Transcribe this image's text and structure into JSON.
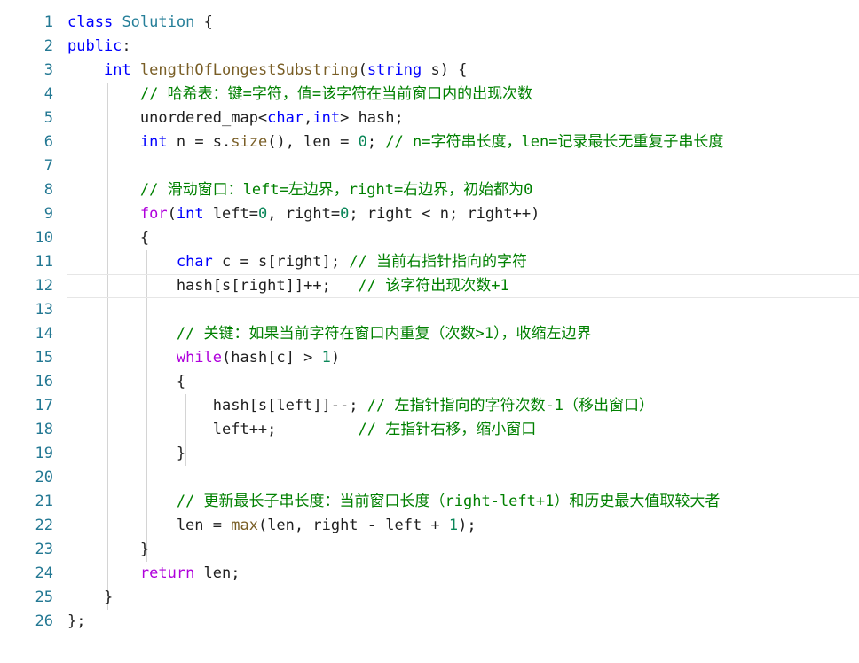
{
  "editor": {
    "lines": [
      {
        "n": "1",
        "tokens": [
          [
            "kw",
            "class"
          ],
          [
            "p",
            " "
          ],
          [
            "cls",
            "Solution"
          ],
          [
            "p",
            " {"
          ]
        ]
      },
      {
        "n": "2",
        "tokens": [
          [
            "kw",
            "public"
          ],
          [
            "p",
            ":"
          ]
        ]
      },
      {
        "n": "3",
        "tokens": [
          [
            "p",
            "    "
          ],
          [
            "ty",
            "int"
          ],
          [
            "p",
            " "
          ],
          [
            "fn",
            "lengthOfLongestSubstring"
          ],
          [
            "p",
            "("
          ],
          [
            "ty",
            "string"
          ],
          [
            "p",
            " s) {"
          ]
        ]
      },
      {
        "n": "4",
        "tokens": [
          [
            "p",
            "        "
          ],
          [
            "cm",
            "// 哈希表：键=字符，值=该字符在当前窗口内的出现次数"
          ]
        ]
      },
      {
        "n": "5",
        "tokens": [
          [
            "p",
            "        unordered_map<"
          ],
          [
            "ty",
            "char"
          ],
          [
            "p",
            ","
          ],
          [
            "ty",
            "int"
          ],
          [
            "p",
            "> hash;"
          ]
        ]
      },
      {
        "n": "6",
        "tokens": [
          [
            "p",
            "        "
          ],
          [
            "ty",
            "int"
          ],
          [
            "p",
            " n = s."
          ],
          [
            "fn",
            "size"
          ],
          [
            "p",
            "(), len = "
          ],
          [
            "num",
            "0"
          ],
          [
            "p",
            "; "
          ],
          [
            "cm",
            "// n=字符串长度，len=记录最长无重复子串长度"
          ]
        ]
      },
      {
        "n": "7",
        "tokens": []
      },
      {
        "n": "8",
        "tokens": [
          [
            "p",
            "        "
          ],
          [
            "cm",
            "// 滑动窗口：left=左边界，right=右边界，初始都为0"
          ]
        ]
      },
      {
        "n": "9",
        "tokens": [
          [
            "p",
            "        "
          ],
          [
            "ctl",
            "for"
          ],
          [
            "p",
            "("
          ],
          [
            "ty",
            "int"
          ],
          [
            "p",
            " left="
          ],
          [
            "num",
            "0"
          ],
          [
            "p",
            ", right="
          ],
          [
            "num",
            "0"
          ],
          [
            "p",
            "; right < n; right++)"
          ]
        ]
      },
      {
        "n": "10",
        "tokens": [
          [
            "p",
            "        {"
          ]
        ]
      },
      {
        "n": "11",
        "tokens": [
          [
            "p",
            "            "
          ],
          [
            "ty",
            "char"
          ],
          [
            "p",
            " c = s[right]; "
          ],
          [
            "cm",
            "// 当前右指针指向的字符"
          ]
        ]
      },
      {
        "n": "12",
        "tokens": [
          [
            "p",
            "            hash[s[right]]++;   "
          ],
          [
            "cm",
            "// 该字符出现次数+1"
          ]
        ]
      },
      {
        "n": "13",
        "tokens": []
      },
      {
        "n": "14",
        "tokens": [
          [
            "p",
            "            "
          ],
          [
            "cm",
            "// 关键：如果当前字符在窗口内重复（次数>1），收缩左边界"
          ]
        ]
      },
      {
        "n": "15",
        "tokens": [
          [
            "p",
            "            "
          ],
          [
            "ctl",
            "while"
          ],
          [
            "p",
            "(hash[c] > "
          ],
          [
            "num",
            "1"
          ],
          [
            "p",
            ")"
          ]
        ]
      },
      {
        "n": "16",
        "tokens": [
          [
            "p",
            "            {"
          ]
        ]
      },
      {
        "n": "17",
        "tokens": [
          [
            "p",
            "                hash[s[left]]--; "
          ],
          [
            "cm",
            "// 左指针指向的字符次数-1（移出窗口）"
          ]
        ]
      },
      {
        "n": "18",
        "tokens": [
          [
            "p",
            "                left++;         "
          ],
          [
            "cm",
            "// 左指针右移，缩小窗口"
          ]
        ]
      },
      {
        "n": "19",
        "tokens": [
          [
            "p",
            "            }"
          ]
        ]
      },
      {
        "n": "20",
        "tokens": []
      },
      {
        "n": "21",
        "tokens": [
          [
            "p",
            "            "
          ],
          [
            "cm",
            "// 更新最长子串长度：当前窗口长度（right-left+1）和历史最大值取较大者"
          ]
        ]
      },
      {
        "n": "22",
        "tokens": [
          [
            "p",
            "            len = "
          ],
          [
            "fn",
            "max"
          ],
          [
            "p",
            "(len, right - left + "
          ],
          [
            "num",
            "1"
          ],
          [
            "p",
            ");"
          ]
        ]
      },
      {
        "n": "23",
        "tokens": [
          [
            "p",
            "        }"
          ]
        ]
      },
      {
        "n": "24",
        "tokens": [
          [
            "p",
            "        "
          ],
          [
            "ctl",
            "return"
          ],
          [
            "p",
            " len;"
          ]
        ]
      },
      {
        "n": "25",
        "tokens": [
          [
            "p",
            "    }"
          ]
        ]
      },
      {
        "n": "26",
        "tokens": [
          [
            "p",
            "};"
          ]
        ]
      }
    ],
    "current_line": "12"
  }
}
